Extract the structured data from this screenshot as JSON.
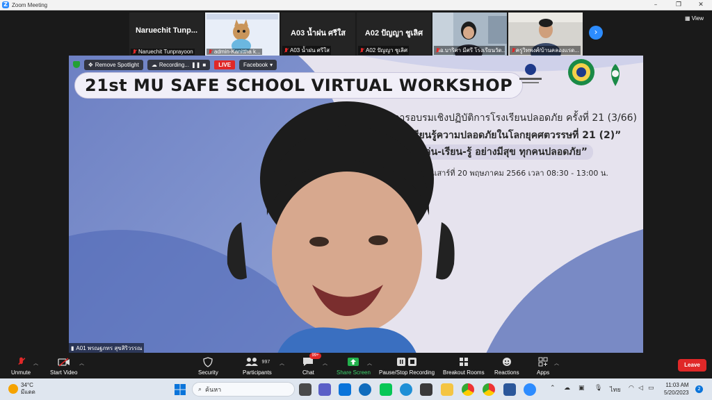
{
  "window": {
    "title": "Zoom Meeting",
    "controls": [
      "–",
      "❐",
      "✕"
    ]
  },
  "strip": {
    "tiles": [
      {
        "name": "Naruechit  Tunp...",
        "footer": "Naruechit Tunprayoon"
      },
      {
        "name": "",
        "footer": "admin-Kanittha k..."
      },
      {
        "name": "A03 น้ำฝน ศรีใส",
        "footer": "A03 น้ำฝน ศรีใส"
      },
      {
        "name": "A02 ปัญญา ชูเลิศ",
        "footer": "A02 ปัญญา ชูเลิศ"
      },
      {
        "name": "",
        "footer": "ผอ.บาริศา มีศรี โรงเรียนวัด..."
      },
      {
        "name": "",
        "footer": "ครูวิทพงศ์/บ้านคลองแรด..."
      }
    ],
    "next_icon": "chevron-right-icon",
    "view_label": "View"
  },
  "speaker": {
    "controls": {
      "remove_spotlight": "Remove Spotlight",
      "recording": "Recording...",
      "live": "LIVE",
      "facebook": "Facebook"
    },
    "workshop_title": "21st MU SAFE SCHOOL VIRTUAL WORKSHOP",
    "lines": [
      "การอบรมเชิงปฏิบัติการโรงเรียนปลอดภัย ครั้งที่ 21 (3/66)",
      "“เรียนรู้ความปลอดภัยในโลกยุคศตวรรษที่ 21 (2)”",
      "“เล่น-เรียน-รู้ อย่างมีสุข ทุกคนปลอดภัย”",
      "วันเสาร์ที่ 20 พฤษภาคม 2566 เวลา 08:30 - 13:00 น."
    ],
    "participant_label": "A01 พรณฐภทร สุขสิริวรรณ"
  },
  "toolbar": {
    "items": [
      {
        "label": "Unmute",
        "icon": "mic-off-icon"
      },
      {
        "label": "Start Video",
        "icon": "video-off-icon"
      },
      {
        "label": "Security",
        "icon": "shield-icon"
      },
      {
        "label": "Participants",
        "icon": "participants-icon",
        "count": "997"
      },
      {
        "label": "Chat",
        "icon": "chat-icon",
        "badge": "99+"
      },
      {
        "label": "Share Screen",
        "icon": "share-screen-icon"
      },
      {
        "label": "Pause/Stop Recording",
        "icon": "recording-icon"
      },
      {
        "label": "Breakout Rooms",
        "icon": "breakout-icon"
      },
      {
        "label": "Reactions",
        "icon": "reactions-icon"
      },
      {
        "label": "Apps",
        "icon": "apps-icon"
      }
    ],
    "leave_label": "Leave"
  },
  "taskbar": {
    "weather": {
      "temp": "34°C",
      "condition": "มีแดด"
    },
    "search_placeholder": "ค้นหา",
    "language": "ไทย",
    "time": "11:03 AM",
    "date": "5/20/2023",
    "notification_count": "2"
  }
}
